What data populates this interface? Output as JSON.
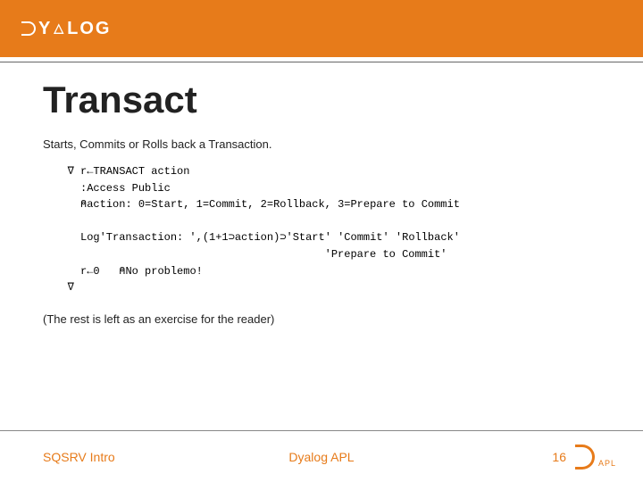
{
  "header": {
    "brand": "DYALOG"
  },
  "title": "Transact",
  "subtitle": "Starts, Commits or Rolls back a Transaction.",
  "code": {
    "l1": "   ∇ r←TRANSACT action",
    "l2": "     :Access Public",
    "l3": "     ⍝action: 0=Start, 1=Commit, 2=Rollback, 3=Prepare to Commit",
    "l4": "",
    "l5": "     Log'Transaction: ',(1+1⊃action)⊃'Start' 'Commit' 'Rollback'",
    "l6": "                                           'Prepare to Commit'",
    "l7": "     r←0   ⍝No problemo!",
    "l8": "   ∇"
  },
  "exercise": "(The rest is left as an exercise for the reader)",
  "footer": {
    "left": "SQSRV Intro",
    "center": "Dyalog APL",
    "page": "16",
    "logomark": "APL"
  }
}
